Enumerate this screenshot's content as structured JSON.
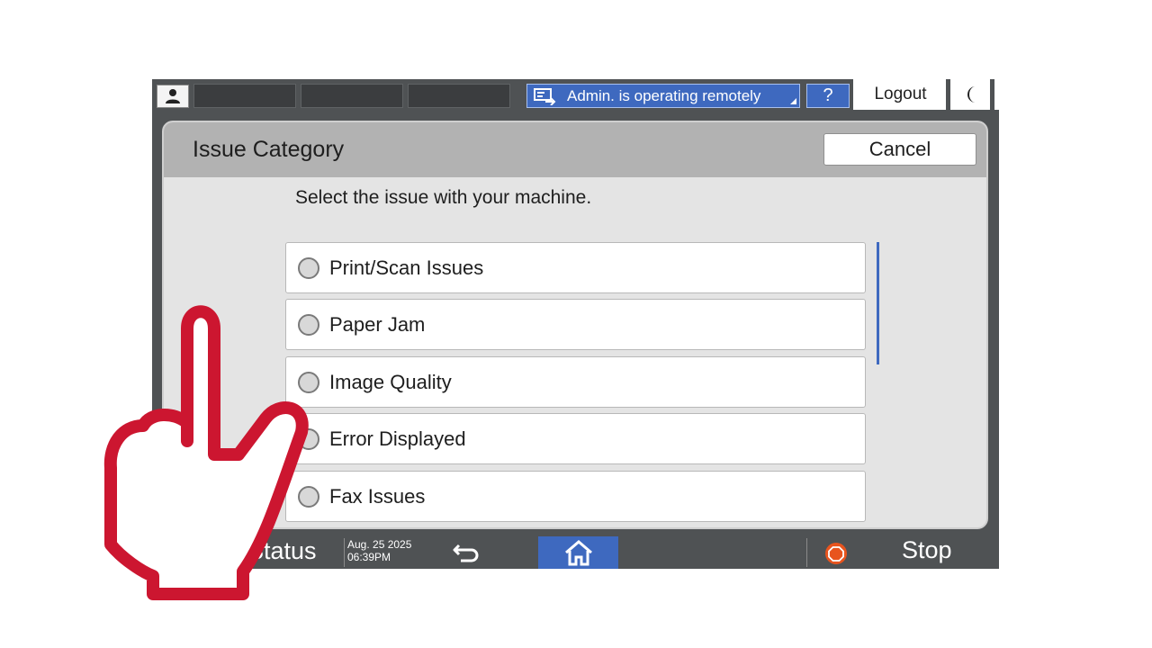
{
  "topbar": {
    "remote_status": "Admin. is operating remotely",
    "help_label": "?",
    "logout_label": "Logout"
  },
  "dialog": {
    "title": "Issue Category",
    "cancel_label": "Cancel",
    "instruction": "Select the issue with your machine.",
    "options": [
      {
        "label": "Print/Scan Issues"
      },
      {
        "label": "Paper Jam"
      },
      {
        "label": "Image Quality"
      },
      {
        "label": "Error Displayed"
      },
      {
        "label": "Fax Issues"
      }
    ]
  },
  "bottombar": {
    "status_label": "Status",
    "date": "Aug. 25 2025",
    "time": "06:39PM",
    "stop_label": "Stop"
  },
  "colors": {
    "accent_blue": "#3e69bf",
    "panel_dark": "#4f5254",
    "hand_red": "#cc1630",
    "stop_orange": "#e8541e"
  },
  "icons": [
    "user-icon",
    "remote-operation-icon",
    "moon-icon",
    "back-arrow-icon",
    "home-icon",
    "stop-icon",
    "pointing-hand-icon"
  ]
}
